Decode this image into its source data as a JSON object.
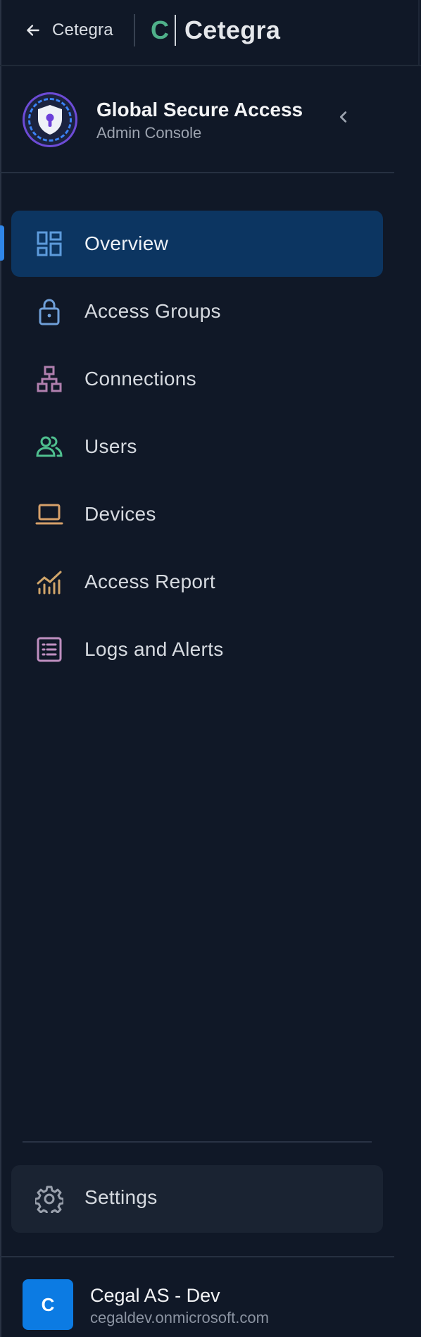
{
  "topbar": {
    "back_label": "Cetegra",
    "brand_letter": "C",
    "brand_name": "Cetegra"
  },
  "app": {
    "title": "Global Secure Access",
    "subtitle": "Admin Console",
    "logo_icon": "shield-keyhole-icon",
    "collapse_icon": "chevron-left-icon"
  },
  "nav": {
    "items": [
      {
        "label": "Overview",
        "icon": "dashboard-icon",
        "color": "#5d9bdc",
        "active": true
      },
      {
        "label": "Access Groups",
        "icon": "lock-icon",
        "color": "#6f9fd8"
      },
      {
        "label": "Connections",
        "icon": "sitemap-icon",
        "color": "#b07fae"
      },
      {
        "label": "Users",
        "icon": "users-icon",
        "color": "#4fbf8f"
      },
      {
        "label": "Devices",
        "icon": "laptop-icon",
        "color": "#d6a06a"
      },
      {
        "label": "Access Report",
        "icon": "chart-trend-icon",
        "color": "#d0a56a"
      },
      {
        "label": "Logs and Alerts",
        "icon": "list-icon",
        "color": "#bf8fc0"
      }
    ]
  },
  "settings": {
    "label": "Settings",
    "icon": "gear-icon",
    "color": "#9aa1ad"
  },
  "org": {
    "avatar_letter": "C",
    "name": "Cegal AS - Dev",
    "domain": "cegaldev.onmicrosoft.com",
    "avatar_color": "#0c7be3"
  }
}
